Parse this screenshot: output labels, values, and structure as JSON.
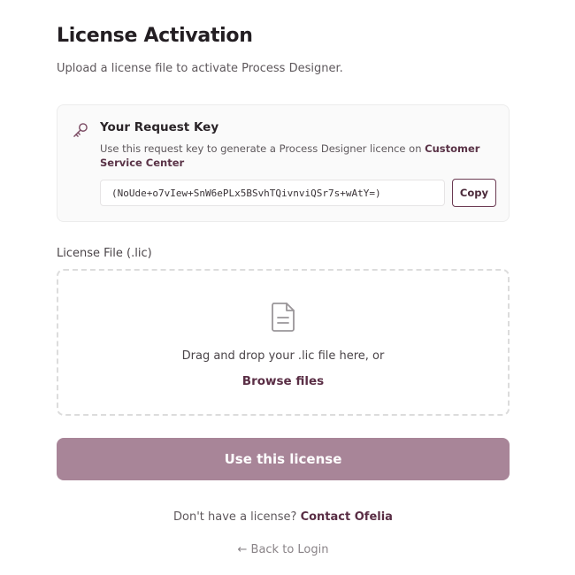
{
  "header": {
    "title": "License Activation",
    "subtitle": "Upload a license file to activate Process Designer."
  },
  "request_key": {
    "icon": "key-icon",
    "title": "Your Request Key",
    "description": "Use this request key to generate a Process Designer licence on ",
    "link_label": "Customer Service Center",
    "value": "(NoUde+o7vIew+SnW6ePLx5BSvhTQivnviQSr7s+wAtY=)",
    "copy_label": "Copy"
  },
  "upload": {
    "label": "License File (.lic)",
    "icon": "file-icon",
    "drop_text": "Drag and drop your .lic file here, or",
    "browse_label": "Browse files"
  },
  "submit_label": "Use this license",
  "footer": {
    "question": "Don't have a license? ",
    "contact_label": "Contact Ofelia",
    "back_label": "← Back to Login"
  },
  "colors": {
    "accent": "#5a2e45",
    "submit_bg": "#a88598"
  }
}
